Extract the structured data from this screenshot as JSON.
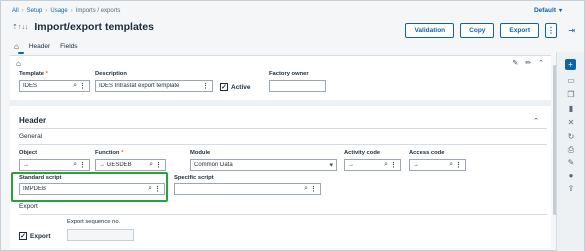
{
  "breadcrumb": [
    "All",
    "Setup",
    "Usage",
    "Imports / exports"
  ],
  "folder": "Default",
  "title": "Import/export templates",
  "sort_icons": "⇡↑↓↓",
  "toolbar": {
    "validation": "Validation",
    "copy": "Copy",
    "export": "Export"
  },
  "tabs": {
    "header": "Header",
    "fields": "Fields"
  },
  "template": {
    "label": "Template",
    "required_mark": "*",
    "value": "IDES"
  },
  "description": {
    "label": "Description",
    "value": "IDES Intrastat export template"
  },
  "active": {
    "label": "Active",
    "checked": true
  },
  "factory_owner": {
    "label": "Factory owner",
    "value": ""
  },
  "header_section": {
    "title": "Header",
    "general": "General",
    "export": "Export"
  },
  "object": {
    "label": "Object",
    "value": "→"
  },
  "function": {
    "label": "Function",
    "required_mark": "*",
    "value": "→  GESDEB"
  },
  "module": {
    "label": "Module",
    "value": "Common Data"
  },
  "activity_code": {
    "label": "Activity code",
    "value": "→"
  },
  "access_code": {
    "label": "Access code",
    "value": "→"
  },
  "standard_script": {
    "label": "Standard script",
    "value": "IMPDEB"
  },
  "specific_script": {
    "label": "Specific script",
    "value": ""
  },
  "export_sequence": {
    "label": "Export sequence no.",
    "value": ""
  },
  "export_check": {
    "label": "Export",
    "checked": true
  },
  "colors": {
    "accent": "#0f63a8",
    "highlight": "#27a33a",
    "required": "#e86a10"
  }
}
